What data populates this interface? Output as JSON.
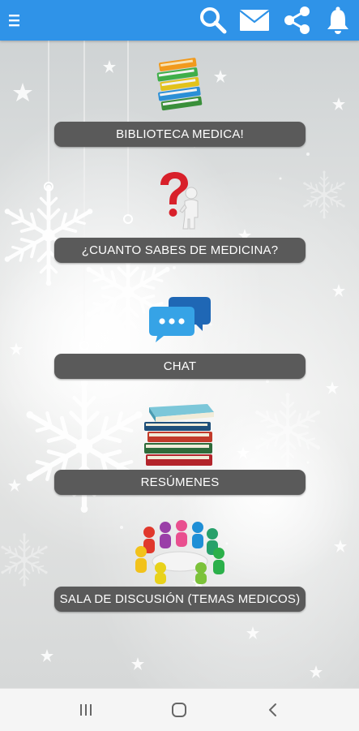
{
  "app_bar": {
    "background": "#2f93e8",
    "icons": [
      "menu-icon",
      "search-icon",
      "mail-icon",
      "share-icon",
      "bell-icon"
    ]
  },
  "menu": {
    "items": [
      {
        "label": "BIBLIOTECA MEDICA!",
        "icon": "books-icon"
      },
      {
        "label": "¿CUANTO SABES DE MEDICINA?",
        "icon": "question-figure-icon"
      },
      {
        "label": "CHAT",
        "icon": "chat-bubbles-icon"
      },
      {
        "label": "RESÚMENES",
        "icon": "book-stack-icon"
      },
      {
        "label": "SALA DE DISCUSIÓN (TEMAS MEDICOS)",
        "icon": "discussion-group-icon"
      }
    ]
  },
  "nav_bar": {
    "icons": [
      "recent-apps-icon",
      "home-icon",
      "back-icon"
    ]
  }
}
